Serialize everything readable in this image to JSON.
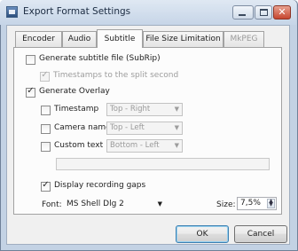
{
  "window": {
    "title": "Export Format Settings",
    "min_glyph": "",
    "close_glyph": "✕"
  },
  "tabs": [
    {
      "label": "Encoder",
      "state": "normal"
    },
    {
      "label": "Audio",
      "state": "normal"
    },
    {
      "label": "Subtitle",
      "state": "active"
    },
    {
      "label": "File Size Limitation",
      "state": "normal"
    },
    {
      "label": "MkPEG",
      "state": "disabled"
    }
  ],
  "subtitle": {
    "generate_subtitle": {
      "label": "Generate subtitle file (SubRip)",
      "checked": false
    },
    "timestamps_split": {
      "label": "Timestamps to the split second",
      "checked": true,
      "enabled": false
    },
    "generate_overlay": {
      "label": "Generate Overlay",
      "checked": true
    },
    "timestamp": {
      "label": "Timestamp",
      "checked": false,
      "position": "Top - Right"
    },
    "camera_name": {
      "label": "Camera name",
      "checked": false,
      "position": "Top - Left"
    },
    "custom_text": {
      "label": "Custom text",
      "checked": false,
      "position": "Bottom - Left",
      "value": ""
    },
    "display_gaps": {
      "label": "Display recording gaps",
      "checked": true
    },
    "font": {
      "label": "Font:",
      "value": "MS Shell Dlg 2"
    },
    "size": {
      "label": "Size:",
      "value": "7,5%"
    }
  },
  "icons": {
    "dropdown": "▼",
    "spin_up": "▲",
    "spin_down": "▼"
  },
  "buttons": {
    "ok": "OK",
    "cancel": "Cancel"
  }
}
